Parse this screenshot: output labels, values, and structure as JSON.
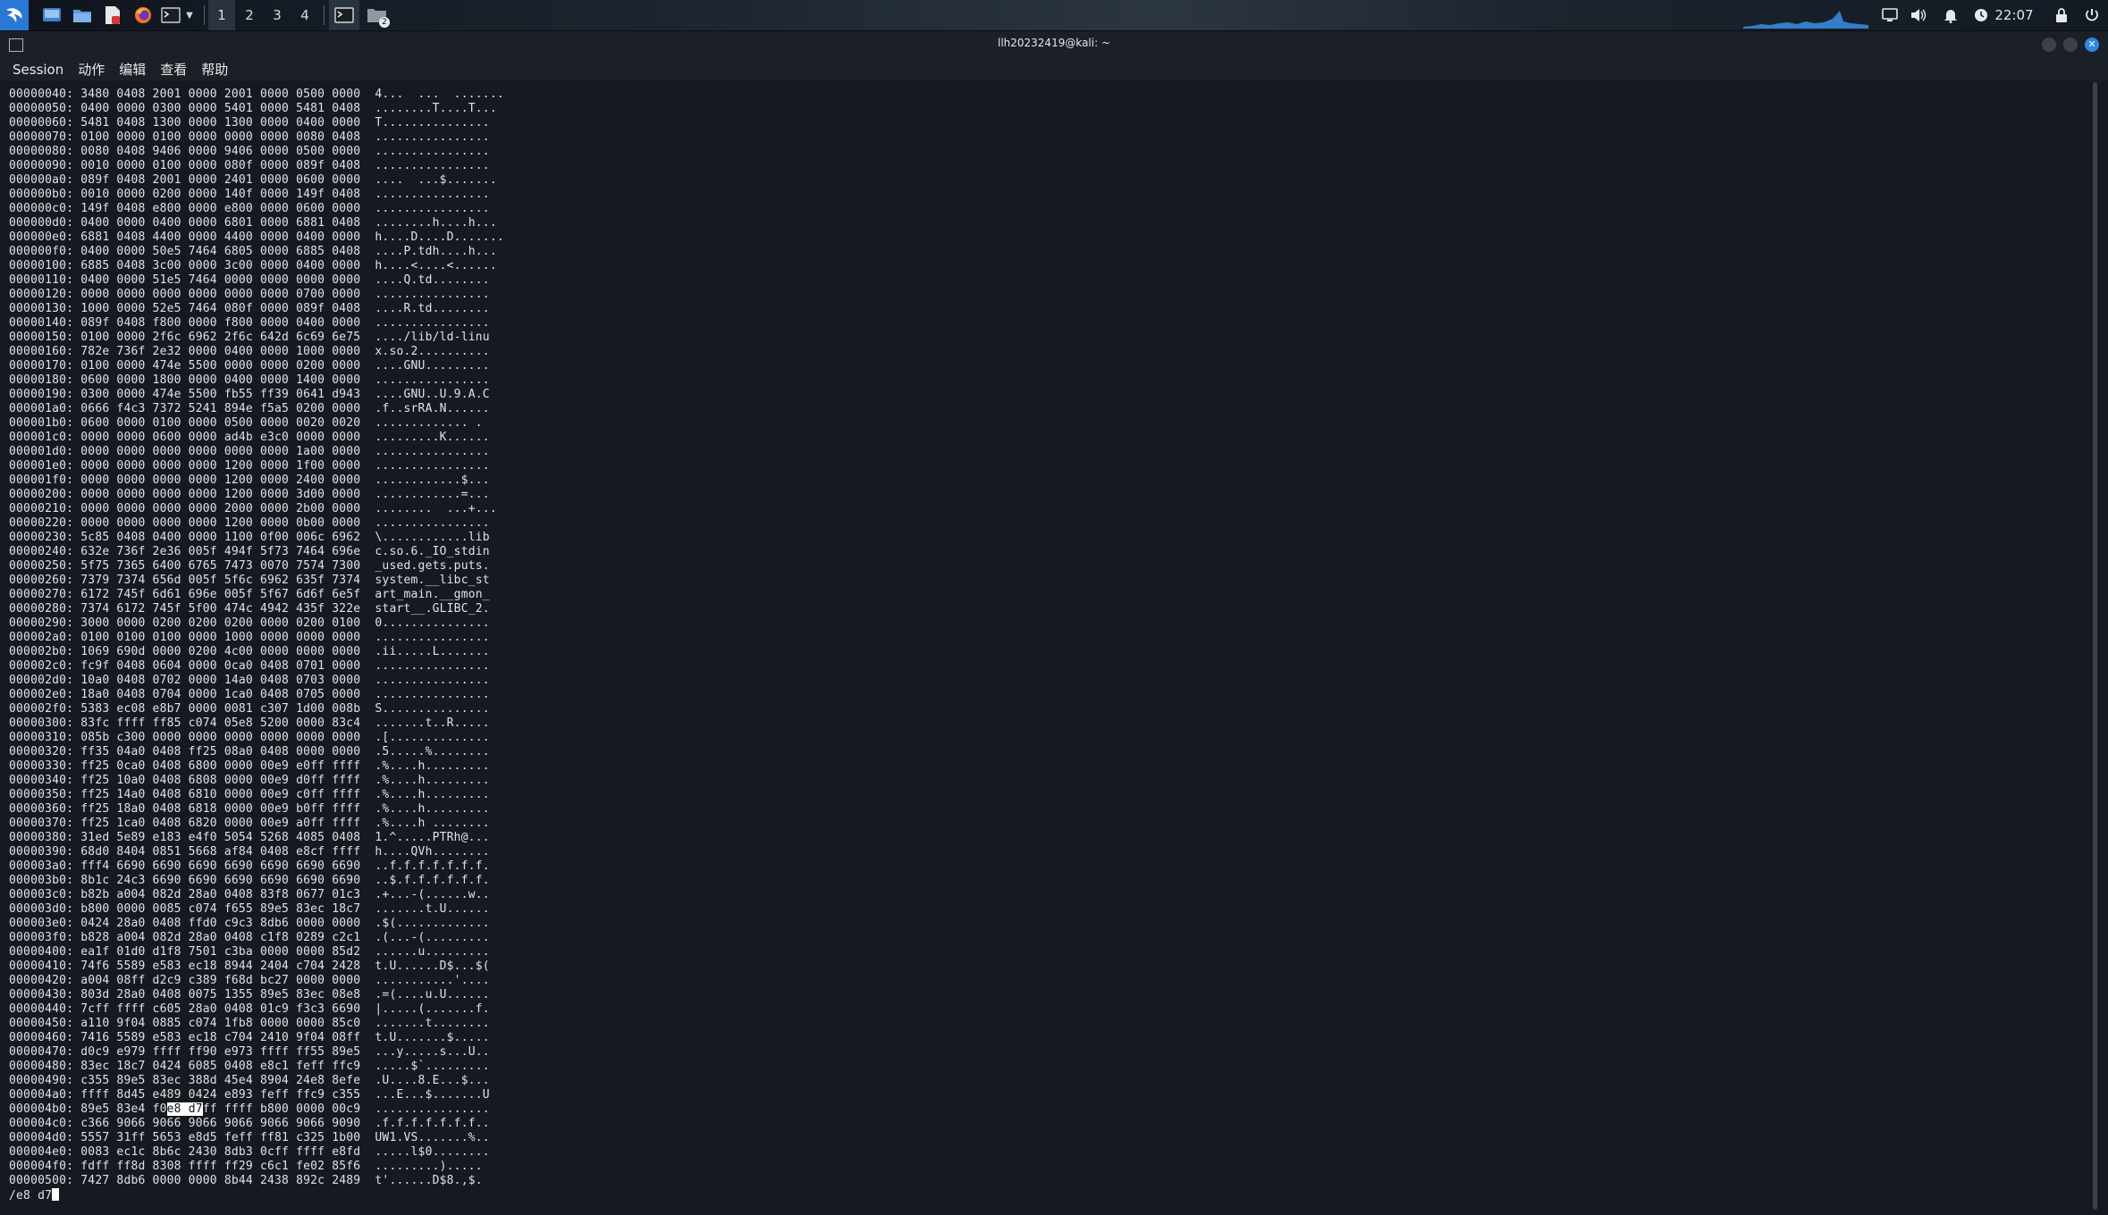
{
  "panel": {
    "workspaces": [
      "1",
      "2",
      "3",
      "4"
    ],
    "active_workspace": "1",
    "clock": "22:07",
    "file_manager_badge": "2",
    "colors": {
      "kali_blue": "#2a78d6",
      "panel_bg": "#1d2631",
      "audio_graph": "#3a8ee6"
    }
  },
  "window": {
    "title": "llh20232419@kali: ~",
    "menu": [
      "Session",
      "动作",
      "编辑",
      "查看",
      "帮助"
    ]
  },
  "hexdump": [
    {
      "offset": "00000040:",
      "hex": "3480 0408 2001 0000 2001 0000 0500 0000",
      "ascii": "4...  ...  ......."
    },
    {
      "offset": "00000050:",
      "hex": "0400 0000 0300 0000 5401 0000 5481 0408",
      "ascii": "........T....T..."
    },
    {
      "offset": "00000060:",
      "hex": "5481 0408 1300 0000 1300 0000 0400 0000",
      "ascii": "T..............."
    },
    {
      "offset": "00000070:",
      "hex": "0100 0000 0100 0000 0000 0000 0080 0408",
      "ascii": "................"
    },
    {
      "offset": "00000080:",
      "hex": "0080 0408 9406 0000 9406 0000 0500 0000",
      "ascii": "................"
    },
    {
      "offset": "00000090:",
      "hex": "0010 0000 0100 0000 080f 0000 089f 0408",
      "ascii": "................"
    },
    {
      "offset": "000000a0:",
      "hex": "089f 0408 2001 0000 2401 0000 0600 0000",
      "ascii": "....  ...$......."
    },
    {
      "offset": "000000b0:",
      "hex": "0010 0000 0200 0000 140f 0000 149f 0408",
      "ascii": "................"
    },
    {
      "offset": "000000c0:",
      "hex": "149f 0408 e800 0000 e800 0000 0600 0000",
      "ascii": "................"
    },
    {
      "offset": "000000d0:",
      "hex": "0400 0000 0400 0000 6801 0000 6881 0408",
      "ascii": "........h....h..."
    },
    {
      "offset": "000000e0:",
      "hex": "6881 0408 4400 0000 4400 0000 0400 0000",
      "ascii": "h....D....D......."
    },
    {
      "offset": "000000f0:",
      "hex": "0400 0000 50e5 7464 6805 0000 6885 0408",
      "ascii": "....P.tdh....h..."
    },
    {
      "offset": "00000100:",
      "hex": "6885 0408 3c00 0000 3c00 0000 0400 0000",
      "ascii": "h....<....<......"
    },
    {
      "offset": "00000110:",
      "hex": "0400 0000 51e5 7464 0000 0000 0000 0000",
      "ascii": "....Q.td........"
    },
    {
      "offset": "00000120:",
      "hex": "0000 0000 0000 0000 0000 0000 0700 0000",
      "ascii": "................"
    },
    {
      "offset": "00000130:",
      "hex": "1000 0000 52e5 7464 080f 0000 089f 0408",
      "ascii": "....R.td........"
    },
    {
      "offset": "00000140:",
      "hex": "089f 0408 f800 0000 f800 0000 0400 0000",
      "ascii": "................"
    },
    {
      "offset": "00000150:",
      "hex": "0100 0000 2f6c 6962 2f6c 642d 6c69 6e75",
      "ascii": "..../lib/ld-linu"
    },
    {
      "offset": "00000160:",
      "hex": "782e 736f 2e32 0000 0400 0000 1000 0000",
      "ascii": "x.so.2.........."
    },
    {
      "offset": "00000170:",
      "hex": "0100 0000 474e 5500 0000 0000 0200 0000",
      "ascii": "....GNU........."
    },
    {
      "offset": "00000180:",
      "hex": "0600 0000 1800 0000 0400 0000 1400 0000",
      "ascii": "................"
    },
    {
      "offset": "00000190:",
      "hex": "0300 0000 474e 5500 fb55 ff39 0641 d943",
      "ascii": "....GNU..U.9.A.C"
    },
    {
      "offset": "000001a0:",
      "hex": "0666 f4c3 7372 5241 894e f5a5 0200 0000",
      "ascii": ".f..srRA.N......"
    },
    {
      "offset": "000001b0:",
      "hex": "0600 0000 0100 0000 0500 0000 0020 0020",
      "ascii": "............. ."
    },
    {
      "offset": "000001c0:",
      "hex": "0000 0000 0600 0000 ad4b e3c0 0000 0000",
      "ascii": ".........K......"
    },
    {
      "offset": "000001d0:",
      "hex": "0000 0000 0000 0000 0000 0000 1a00 0000",
      "ascii": "................"
    },
    {
      "offset": "000001e0:",
      "hex": "0000 0000 0000 0000 1200 0000 1f00 0000",
      "ascii": "................"
    },
    {
      "offset": "000001f0:",
      "hex": "0000 0000 0000 0000 1200 0000 2400 0000",
      "ascii": "............$..."
    },
    {
      "offset": "00000200:",
      "hex": "0000 0000 0000 0000 1200 0000 3d00 0000",
      "ascii": "............=..."
    },
    {
      "offset": "00000210:",
      "hex": "0000 0000 0000 0000 2000 0000 2b00 0000",
      "ascii": "........  ...+..."
    },
    {
      "offset": "00000220:",
      "hex": "0000 0000 0000 0000 1200 0000 0b00 0000",
      "ascii": "................"
    },
    {
      "offset": "00000230:",
      "hex": "5c85 0408 0400 0000 1100 0f00 006c 6962",
      "ascii": "\\............lib"
    },
    {
      "offset": "00000240:",
      "hex": "632e 736f 2e36 005f 494f 5f73 7464 696e",
      "ascii": "c.so.6._IO_stdin"
    },
    {
      "offset": "00000250:",
      "hex": "5f75 7365 6400 6765 7473 0070 7574 7300",
      "ascii": "_used.gets.puts."
    },
    {
      "offset": "00000260:",
      "hex": "7379 7374 656d 005f 5f6c 6962 635f 7374",
      "ascii": "system.__libc_st"
    },
    {
      "offset": "00000270:",
      "hex": "6172 745f 6d61 696e 005f 5f67 6d6f 6e5f",
      "ascii": "art_main.__gmon_"
    },
    {
      "offset": "00000280:",
      "hex": "7374 6172 745f 5f00 474c 4942 435f 322e",
      "ascii": "start__.GLIBC_2."
    },
    {
      "offset": "00000290:",
      "hex": "3000 0000 0200 0200 0200 0000 0200 0100",
      "ascii": "0..............."
    },
    {
      "offset": "000002a0:",
      "hex": "0100 0100 0100 0000 1000 0000 0000 0000",
      "ascii": "................"
    },
    {
      "offset": "000002b0:",
      "hex": "1069 690d 0000 0200 4c00 0000 0000 0000",
      "ascii": ".ii.....L......."
    },
    {
      "offset": "000002c0:",
      "hex": "fc9f 0408 0604 0000 0ca0 0408 0701 0000",
      "ascii": "................"
    },
    {
      "offset": "000002d0:",
      "hex": "10a0 0408 0702 0000 14a0 0408 0703 0000",
      "ascii": "................"
    },
    {
      "offset": "000002e0:",
      "hex": "18a0 0408 0704 0000 1ca0 0408 0705 0000",
      "ascii": "................"
    },
    {
      "offset": "000002f0:",
      "hex": "5383 ec08 e8b7 0000 0081 c307 1d00 008b",
      "ascii": "S..............."
    },
    {
      "offset": "00000300:",
      "hex": "83fc ffff ff85 c074 05e8 5200 0000 83c4",
      "ascii": ".......t..R....."
    },
    {
      "offset": "00000310:",
      "hex": "085b c300 0000 0000 0000 0000 0000 0000",
      "ascii": ".[.............."
    },
    {
      "offset": "00000320:",
      "hex": "ff35 04a0 0408 ff25 08a0 0408 0000 0000",
      "ascii": ".5.....%........"
    },
    {
      "offset": "00000330:",
      "hex": "ff25 0ca0 0408 6800 0000 00e9 e0ff ffff",
      "ascii": ".%....h........."
    },
    {
      "offset": "00000340:",
      "hex": "ff25 10a0 0408 6808 0000 00e9 d0ff ffff",
      "ascii": ".%....h........."
    },
    {
      "offset": "00000350:",
      "hex": "ff25 14a0 0408 6810 0000 00e9 c0ff ffff",
      "ascii": ".%....h........."
    },
    {
      "offset": "00000360:",
      "hex": "ff25 18a0 0408 6818 0000 00e9 b0ff ffff",
      "ascii": ".%....h........."
    },
    {
      "offset": "00000370:",
      "hex": "ff25 1ca0 0408 6820 0000 00e9 a0ff ffff",
      "ascii": ".%....h ........"
    },
    {
      "offset": "00000380:",
      "hex": "31ed 5e89 e183 e4f0 5054 5268 4085 0408",
      "ascii": "1.^.....PTRh@..."
    },
    {
      "offset": "00000390:",
      "hex": "68d0 8404 0851 5668 af84 0408 e8cf ffff",
      "ascii": "h....QVh........"
    },
    {
      "offset": "000003a0:",
      "hex": "fff4 6690 6690 6690 6690 6690 6690 6690",
      "ascii": "..f.f.f.f.f.f.f."
    },
    {
      "offset": "000003b0:",
      "hex": "8b1c 24c3 6690 6690 6690 6690 6690 6690",
      "ascii": "..$.f.f.f.f.f.f."
    },
    {
      "offset": "000003c0:",
      "hex": "b82b a004 082d 28a0 0408 83f8 0677 01c3",
      "ascii": ".+...-(......w.."
    },
    {
      "offset": "000003d0:",
      "hex": "b800 0000 0085 c074 f655 89e5 83ec 18c7",
      "ascii": ".......t.U......"
    },
    {
      "offset": "000003e0:",
      "hex": "0424 28a0 0408 ffd0 c9c3 8db6 0000 0000",
      "ascii": ".$(............."
    },
    {
      "offset": "000003f0:",
      "hex": "b828 a004 082d 28a0 0408 c1f8 0289 c2c1",
      "ascii": ".(...-(........."
    },
    {
      "offset": "00000400:",
      "hex": "ea1f 01d0 d1f8 7501 c3ba 0000 0000 85d2",
      "ascii": "......u........."
    },
    {
      "offset": "00000410:",
      "hex": "74f6 5589 e583 ec18 8944 2404 c704 2428",
      "ascii": "t.U......D$...$("
    },
    {
      "offset": "00000420:",
      "hex": "a004 08ff d2c9 c389 f68d bc27 0000 0000",
      "ascii": "...........'...."
    },
    {
      "offset": "00000430:",
      "hex": "803d 28a0 0408 0075 1355 89e5 83ec 08e8",
      "ascii": ".=(....u.U......"
    },
    {
      "offset": "00000440:",
      "hex": "7cff ffff c605 28a0 0408 01c9 f3c3 6690",
      "ascii": "|.....(.......f."
    },
    {
      "offset": "00000450:",
      "hex": "a110 9f04 0885 c074 1fb8 0000 0000 85c0",
      "ascii": ".......t........"
    },
    {
      "offset": "00000460:",
      "hex": "7416 5589 e583 ec18 c704 2410 9f04 08ff",
      "ascii": "t.U.......$....."
    },
    {
      "offset": "00000470:",
      "hex": "d0c9 e979 ffff ff90 e973 ffff ff55 89e5",
      "ascii": "...y.....s...U.."
    },
    {
      "offset": "00000480:",
      "hex": "83ec 18c7 0424 6085 0408 e8c1 feff ffc9",
      "ascii": ".....$`........."
    },
    {
      "offset": "00000490:",
      "hex": "c355 89e5 83ec 388d 45e4 8904 24e8 8efe",
      "ascii": ".U....8.E...$..."
    },
    {
      "offset": "000004a0:",
      "hex": "ffff 8d45 e489 0424 e893 feff ffc9 c355",
      "ascii": "...E...$.......U"
    },
    {
      "offset": "000004b0:",
      "hex": "89e5 83e4 f0e8 d7ff ffff b800 0000 00c9",
      "ascii": "................"
    },
    {
      "offset": "000004c0:",
      "hex": "c366 9066 9066 9066 9066 9066 9066 9090",
      "ascii": ".f.f.f.f.f.f.f.."
    },
    {
      "offset": "000004d0:",
      "hex": "5557 31ff 5653 e8d5 feff ff81 c325 1b00",
      "ascii": "UW1.VS.......%.."
    },
    {
      "offset": "000004e0:",
      "hex": "0083 ec1c 8b6c 2430 8db3 0cff ffff e8fd",
      "ascii": ".....l$0........"
    },
    {
      "offset": "000004f0:",
      "hex": "fdff ff8d 8308 ffff ff29 c6c1 fe02 85f6",
      "ascii": ".........).....",
      "note_unused": ""
    },
    {
      "offset": "00000500:",
      "hex": "7427 8db6 0000 0000 8b44 2438 892c 2489",
      "ascii": "t'......D$8.,$."
    }
  ],
  "highlight": {
    "row_offset": "000004b0:",
    "hex_before": "89e5 83e4 f0",
    "hex_match": "e8 d7",
    "hex_after": "ff ffff b800 0000 00c9",
    "ascii": "................"
  },
  "command_line": "/e8 d7"
}
